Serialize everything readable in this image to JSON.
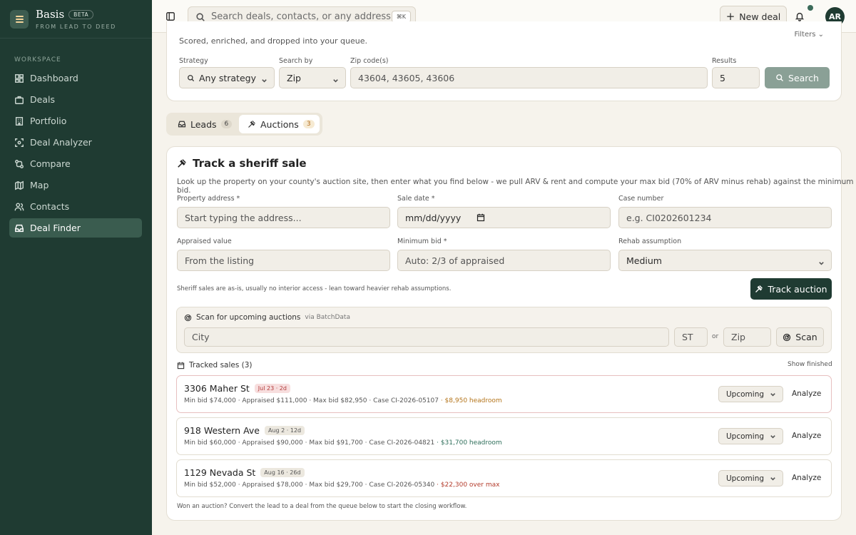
{
  "brand": {
    "name": "Basis",
    "badge": "BETA",
    "tagline": "FROM LEAD TO DEED"
  },
  "sidebar": {
    "section": "WORKSPACE",
    "items": [
      {
        "label": "Dashboard",
        "icon": "dashboard-icon"
      },
      {
        "label": "Deals",
        "icon": "briefcase-icon"
      },
      {
        "label": "Portfolio",
        "icon": "building-icon"
      },
      {
        "label": "Deal Analyzer",
        "icon": "analyzer-icon"
      },
      {
        "label": "Compare",
        "icon": "compare-icon"
      },
      {
        "label": "Map",
        "icon": "map-icon"
      },
      {
        "label": "Contacts",
        "icon": "users-icon"
      },
      {
        "label": "Deal Finder",
        "icon": "inbox-icon"
      }
    ],
    "active": "Deal Finder"
  },
  "topbar": {
    "search_placeholder": "Search deals, contacts, or any address...",
    "shortcut": "⌘K",
    "new_deal": "New deal",
    "avatar": "AR"
  },
  "finder": {
    "subtitle": "Scored, enriched, and dropped into your queue.",
    "filters": "Filters",
    "strategy_label": "Strategy",
    "strategy_value": "Any strategy",
    "searchby_label": "Search by",
    "searchby_value": "Zip",
    "zip_label": "Zip code(s)",
    "zip_placeholder": "43604, 43605, 43606",
    "results_label": "Results",
    "results_value": "5",
    "search_button": "Search"
  },
  "tabs": [
    {
      "label": "Leads",
      "count": "6"
    },
    {
      "label": "Auctions",
      "count": "3"
    }
  ],
  "track": {
    "title": "Track a sheriff sale",
    "description": "Look up the property on your county's auction site, then enter what you find below - we pull ARV & rent and compute your max bid (70% of ARV minus rehab) against the minimum bid.",
    "address_label": "Property address *",
    "address_placeholder": "Start typing the address...",
    "sale_date_label": "Sale date *",
    "sale_date_placeholder": "mm/dd/yyyy",
    "case_label": "Case number",
    "case_placeholder": "e.g. CI0202601234",
    "appraised_label": "Appraised value",
    "appraised_placeholder": "From the listing",
    "minbid_label": "Minimum bid *",
    "minbid_placeholder": "Auto: 2/3 of appraised",
    "rehab_label": "Rehab assumption",
    "rehab_value": "Medium",
    "hint": "Sheriff sales are as-is, usually no interior access - lean toward heavier rehab assumptions.",
    "track_button": "Track auction"
  },
  "scan": {
    "title": "Scan for upcoming auctions",
    "via": "via BatchData",
    "city_placeholder": "City",
    "state_placeholder": "ST",
    "or": "or",
    "zip_placeholder": "Zip",
    "button": "Scan"
  },
  "tracked": {
    "title": "Tracked sales (3)",
    "show_finished": "Show finished",
    "rows": [
      {
        "address": "3306 Maher St",
        "date": "Jul 23 · 2d",
        "meta": "Min bid $74,000 · Appraised $111,000 · Max bid $82,950 · Case CI-2026-05107",
        "headroom": "· $8,950 headroom",
        "status": "Upcoming",
        "action": "Analyze"
      },
      {
        "address": "918 Western Ave",
        "date": "Aug 2 · 12d",
        "meta": "Min bid $60,000 · Appraised $90,000 · Max bid $91,700 · Case CI-2026-04821",
        "headroom": "· $31,700 headroom",
        "status": "Upcoming",
        "action": "Analyze"
      },
      {
        "address": "1129 Nevada St",
        "date": "Aug 16 · 26d",
        "meta": "Min bid $52,000 · Appraised $78,000 · Max bid $29,700 · Case CI-2026-05340",
        "headroom": "· $22,300 over max",
        "status": "Upcoming",
        "action": "Analyze"
      }
    ],
    "footer": "Won an auction? Convert the lead to a deal from the queue below to start the closing workflow."
  }
}
